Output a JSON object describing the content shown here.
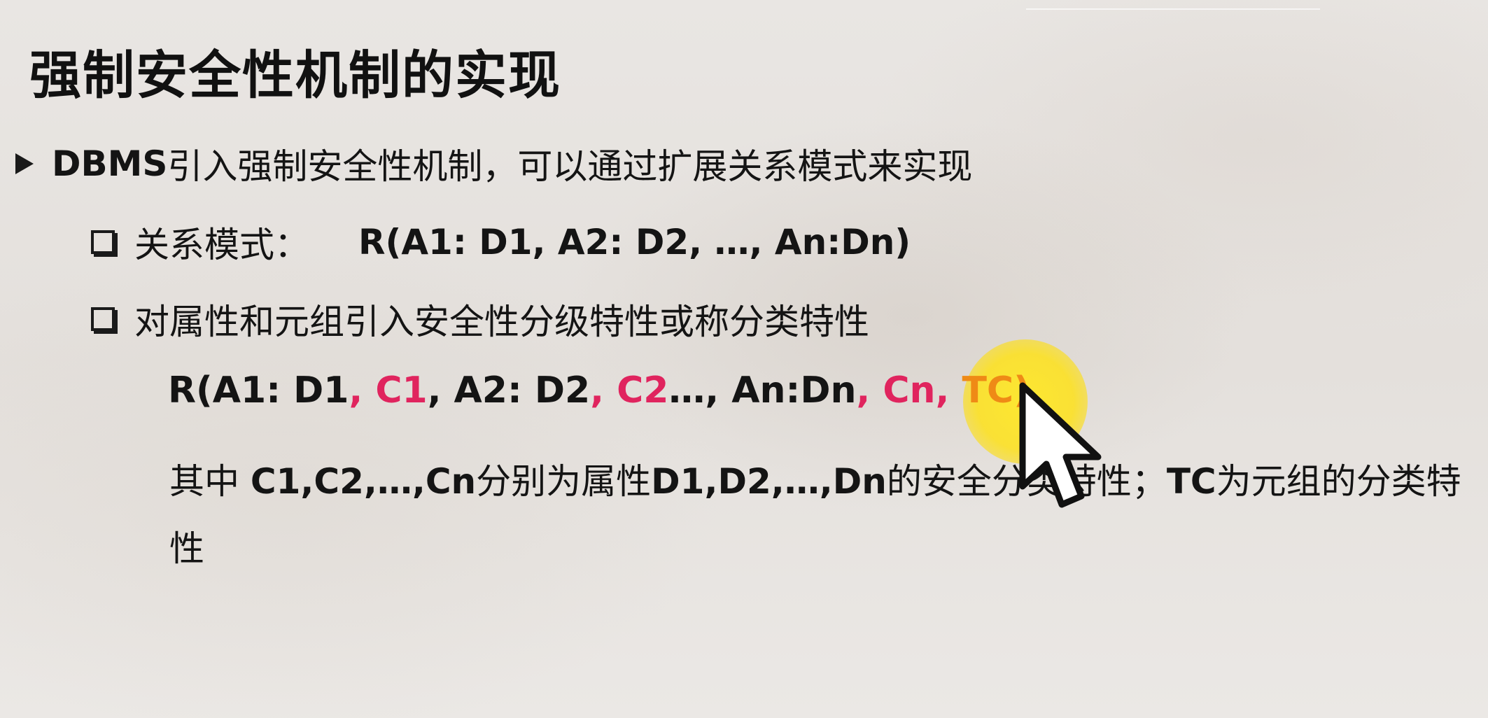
{
  "slide": {
    "title": "强制安全性机制的实现",
    "bullet1": {
      "prefix": "DBMS",
      "text": "引入强制安全性机制，可以通过扩展关系模式来实现"
    },
    "bullet2": {
      "label": "关系模式：",
      "formula": "R(A1: D1, A2: D2, …, An:Dn)"
    },
    "bullet3": {
      "text": "对属性和元组引入安全性分级特性或称分类特性"
    },
    "formula2": {
      "p1": "R(A1: D1",
      "p2": ", C1",
      "p3": ", A2: D2",
      "p4": ", C2",
      "p5": "…, An:Dn",
      "p6": ", Cn, ",
      "p7": "TC)"
    },
    "explanation": {
      "t1": "其中 ",
      "t2": "C1,C2,…,Cn",
      "t3": "分别为属性",
      "t4": "D1,D2,…,Dn",
      "t5": "的安全分类特性；",
      "t6": "TC",
      "t7": "为元组的分类特性"
    }
  },
  "colors": {
    "highlight_red": "#e0245e",
    "highlight_orange": "#ef8a16",
    "cursor_highlight": "#ffe828"
  },
  "icons": {
    "bullet_level1": "right-triangle-bullet-icon",
    "bullet_level2": "hollow-square-bullet-icon",
    "pointer": "mouse-pointer-icon"
  }
}
